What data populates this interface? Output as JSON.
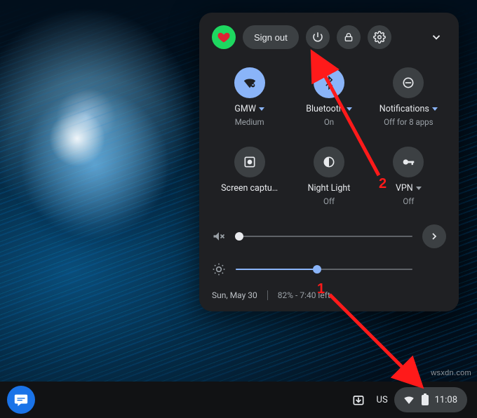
{
  "panel": {
    "sign_out": "Sign out",
    "tiles": {
      "wifi": {
        "label": "GMW",
        "sub": "Medium",
        "on": true
      },
      "bt": {
        "label": "Bluetooth",
        "sub": "On",
        "on": true
      },
      "notif": {
        "label": "Notifications",
        "sub": "Off for 8 apps",
        "on": false
      },
      "capture": {
        "label": "Screen captu…",
        "sub": "",
        "on": false
      },
      "night": {
        "label": "Night Light",
        "sub": "Off",
        "on": false
      },
      "vpn": {
        "label": "VPN",
        "sub": "Off",
        "on": false
      }
    },
    "sliders": {
      "volume_pct": 2,
      "brightness_pct": 46
    },
    "footer": {
      "date": "Sun, May 30",
      "battery": "82% - 7:40 left"
    }
  },
  "shelf": {
    "ime": "US",
    "clock": "11:08"
  },
  "annotations": {
    "step1": "1",
    "step2": "2"
  },
  "watermark": "wsxdn.com"
}
